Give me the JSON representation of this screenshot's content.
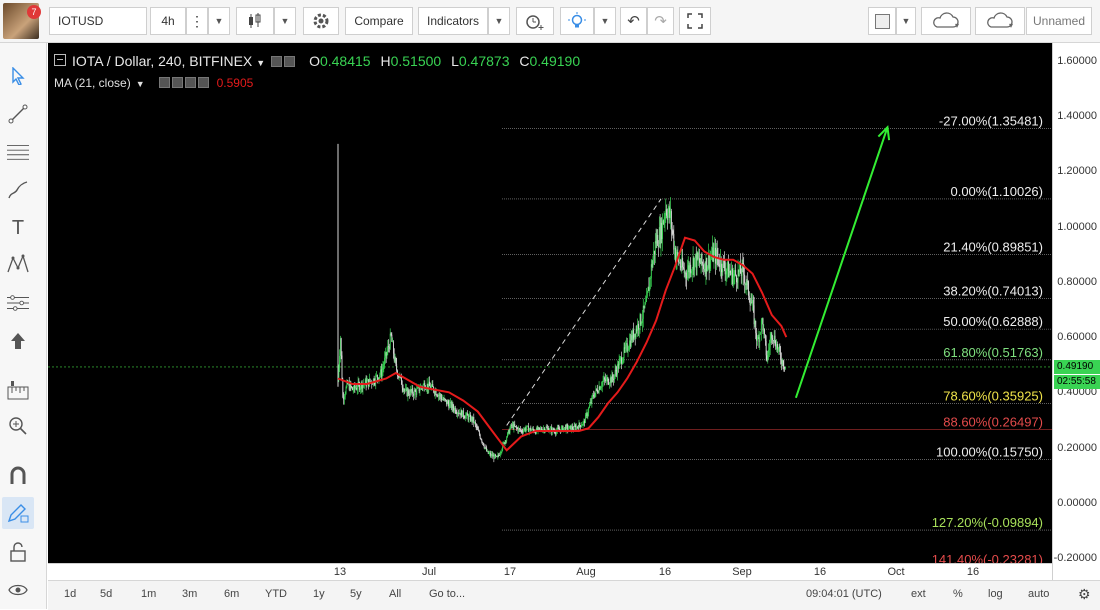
{
  "toolbar": {
    "notification_count": "7",
    "symbol": "IOTUSD",
    "interval": "4h",
    "compare_label": "Compare",
    "indicators_label": "Indicators",
    "layout_name": "Unnamed"
  },
  "legend": {
    "title": "IOTA / Dollar, 240, BITFINEX",
    "o_label": "O",
    "o": "0.48415",
    "h_label": "H",
    "h": "0.51500",
    "l_label": "L",
    "l": "0.47873",
    "c_label": "C",
    "c": "0.49190",
    "ma_label": "MA (21, close)",
    "ma_value": "0.5905"
  },
  "colors": {
    "candle_up": "#39d353",
    "candle_down": "#d8d8d8",
    "ma": "#e51b1b",
    "arrow": "#33ee33",
    "fib_line": "#9a9a9a",
    "fib_label_default": "#eeeeee",
    "fib_label_618": "#7fe07f",
    "fib_label_786": "#f0e34a",
    "fib_label_886": "#e44b4b",
    "fib_label_1272": "#a8e05a",
    "fib_label_1414": "#e44b4b"
  },
  "chart_data": {
    "type": "candlestick",
    "symbol": "IOTA / Dollar, 240, BITFINEX",
    "ylim": [
      -0.2,
      1.6
    ],
    "y_ticks": [
      "1.60000",
      "1.40000",
      "1.20000",
      "1.00000",
      "0.80000",
      "0.60000",
      "0.40000",
      "0.20000",
      "0.00000",
      "-0.20000"
    ],
    "last_price": "0.49190",
    "countdown": "02:55:58",
    "x_ticks": [
      "13",
      "Jul",
      "17",
      "Aug",
      "16",
      "Sep",
      "16",
      "Oct",
      "16"
    ],
    "price_path": {
      "x_day": [
        0,
        0.5,
        1,
        2,
        3,
        5,
        7,
        9,
        11,
        12,
        14,
        16,
        18,
        20,
        22,
        25,
        28,
        31,
        33,
        35,
        36,
        37,
        38,
        39,
        41,
        43,
        45,
        47,
        49,
        51,
        53,
        55,
        57,
        59,
        61,
        63,
        64,
        65,
        66,
        67,
        68,
        69,
        70,
        72,
        74,
        76,
        78,
        80,
        82,
        84,
        86,
        87,
        88,
        89,
        90,
        91,
        92,
        93
      ],
      "close": [
        0.45,
        0.6,
        0.38,
        0.43,
        0.41,
        0.43,
        0.44,
        0.47,
        0.6,
        0.49,
        0.4,
        0.4,
        0.43,
        0.41,
        0.37,
        0.33,
        0.3,
        0.18,
        0.16,
        0.24,
        0.28,
        0.27,
        0.26,
        0.27,
        0.26,
        0.27,
        0.26,
        0.27,
        0.27,
        0.29,
        0.39,
        0.44,
        0.45,
        0.53,
        0.6,
        0.67,
        0.72,
        0.85,
        0.95,
        0.98,
        1.07,
        1.03,
        0.9,
        0.83,
        0.88,
        0.86,
        0.9,
        0.86,
        0.82,
        0.84,
        0.71,
        0.58,
        0.66,
        0.52,
        0.62,
        0.57,
        0.52,
        0.49
      ]
    },
    "ma_21": {
      "x_day": [
        0,
        3,
        6,
        10,
        12,
        14,
        17,
        20,
        23,
        26,
        29,
        32,
        35,
        38,
        41,
        44,
        47,
        50,
        52,
        54,
        56,
        58,
        60,
        62,
        64,
        66,
        68,
        70,
        72,
        74,
        76,
        78,
        80,
        82,
        84,
        86,
        88,
        90,
        92,
        93
      ],
      "value": [
        0.45,
        0.43,
        0.43,
        0.45,
        0.47,
        0.45,
        0.42,
        0.41,
        0.4,
        0.37,
        0.33,
        0.26,
        0.19,
        0.24,
        0.26,
        0.26,
        0.26,
        0.26,
        0.27,
        0.31,
        0.36,
        0.4,
        0.45,
        0.51,
        0.58,
        0.66,
        0.77,
        0.86,
        0.96,
        0.95,
        0.91,
        0.89,
        0.88,
        0.88,
        0.86,
        0.83,
        0.76,
        0.68,
        0.64,
        0.6
      ]
    },
    "wick_spike_high": 1.3,
    "fibonacci": [
      {
        "label": "-27.00%(1.35481)",
        "value": 1.35481
      },
      {
        "label": "0.00%(1.10026)",
        "value": 1.10026
      },
      {
        "label": "21.40%(0.89851)",
        "value": 0.89851
      },
      {
        "label": "38.20%(0.74013)",
        "value": 0.74013
      },
      {
        "label": "50.00%(0.62888)",
        "value": 0.62888
      },
      {
        "label": "61.80%(0.51763)",
        "value": 0.51763
      },
      {
        "label": "78.60%(0.35925)",
        "value": 0.35925
      },
      {
        "label": "88.60%(0.26497)",
        "value": 0.26497
      },
      {
        "label": "100.00%(0.15750)",
        "value": 0.1575
      },
      {
        "label": "127.20%(-0.09894)",
        "value": -0.09894
      },
      {
        "label": "141.40%(-0.23281)",
        "value": -0.23281
      }
    ],
    "trend_line": {
      "from": {
        "x_day": 35,
        "value": 0.28
      },
      "to": {
        "x_day": 67,
        "value": 1.1
      }
    },
    "arrow": {
      "from": {
        "x_day": 95,
        "value": 0.38
      },
      "to": {
        "x_day": 114,
        "value": 1.36
      }
    }
  },
  "time_bar": {
    "ranges": [
      "1d",
      "5d",
      "1m",
      "3m",
      "6m",
      "YTD",
      "1y",
      "5y",
      "All"
    ],
    "goto": "Go to...",
    "clock": "09:04:01 (UTC)",
    "ext": "ext",
    "percent": "%",
    "log": "log",
    "auto": "auto"
  }
}
